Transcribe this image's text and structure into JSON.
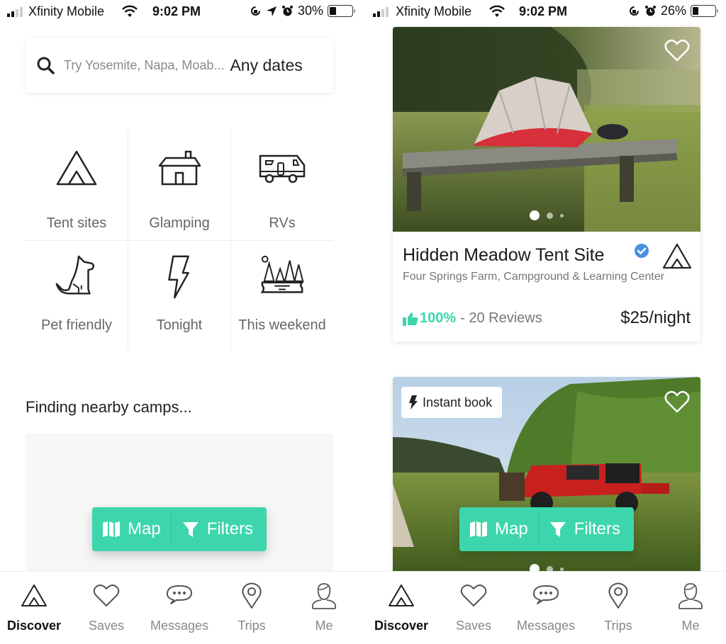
{
  "left_screen": {
    "status_bar": {
      "carrier": "Xfinity Mobile",
      "time": "9:02 PM",
      "battery_percent": "30%",
      "battery_level": 0.3,
      "indicators": [
        "orientation-lock-icon",
        "location-arrow-icon",
        "alarm-icon"
      ]
    },
    "search": {
      "placeholder": "Try Yosemite, Napa, Moab...",
      "dates": "Any dates"
    },
    "categories": [
      {
        "label": "Tent sites",
        "icon": "tent-icon"
      },
      {
        "label": "Glamping",
        "icon": "cabin-icon"
      },
      {
        "label": "RVs",
        "icon": "rv-icon"
      },
      {
        "label": "Pet friendly",
        "icon": "dog-icon"
      },
      {
        "label": "Tonight",
        "icon": "lightning-icon"
      },
      {
        "label": "This weekend",
        "icon": "forest-icon"
      }
    ],
    "section_title": "Finding nearby camps...",
    "map_filters": {
      "map_label": "Map",
      "filters_label": "Filters"
    }
  },
  "right_screen": {
    "status_bar": {
      "carrier": "Xfinity Mobile",
      "time": "9:02 PM",
      "battery_percent": "26%",
      "battery_level": 0.26,
      "indicators": [
        "orientation-lock-icon",
        "alarm-icon"
      ]
    },
    "listings": [
      {
        "title": "Hidden Meadow Tent Site",
        "verified": true,
        "type_icon": "tent-icon",
        "subtitle": "Four Springs Farm, Campground & Learning Center",
        "rating_percent": "100%",
        "reviews": "- 20 Reviews",
        "price": "$25/night",
        "photo_count": 3,
        "active_photo": 1
      },
      {
        "badge": "Instant book",
        "photo_count": 3,
        "active_photo": 1
      }
    ],
    "map_filters": {
      "map_label": "Map",
      "filters_label": "Filters"
    }
  },
  "bottom_nav": [
    {
      "label": "Discover",
      "icon": "tent-icon",
      "active": true
    },
    {
      "label": "Saves",
      "icon": "heart-icon",
      "active": false
    },
    {
      "label": "Messages",
      "icon": "chat-bubble-icon",
      "active": false
    },
    {
      "label": "Trips",
      "icon": "map-pin-icon",
      "active": false
    },
    {
      "label": "Me",
      "icon": "user-icon",
      "active": false
    }
  ],
  "colors": {
    "accent": "#3dd6ac",
    "verified": "#4a90e2",
    "text_primary": "#222222",
    "text_secondary": "#777777"
  }
}
